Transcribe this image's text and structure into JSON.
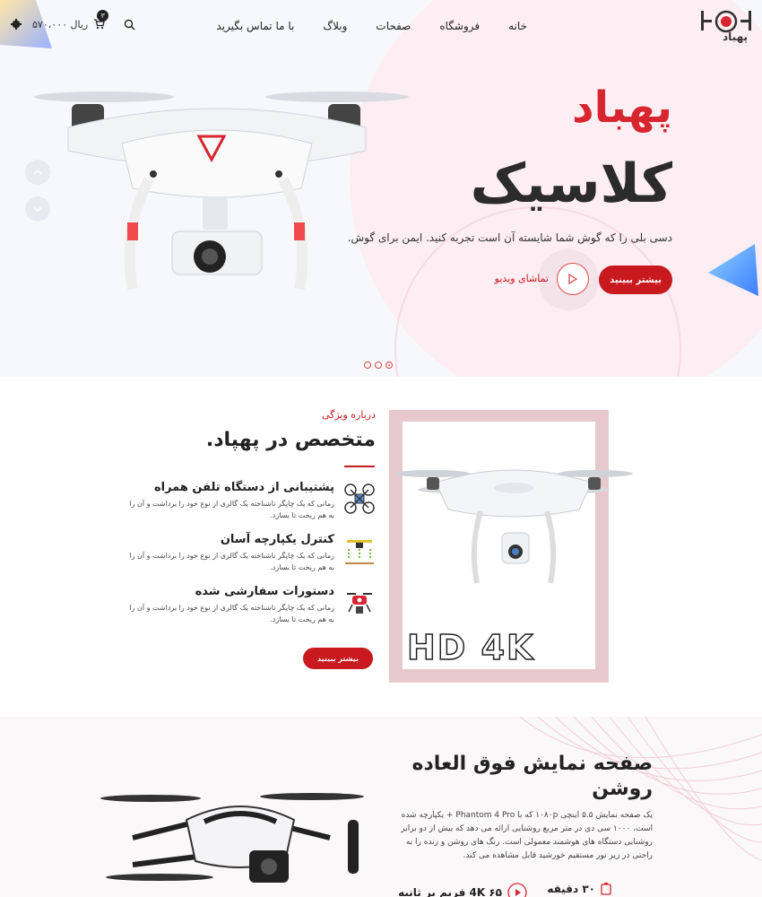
{
  "header": {
    "logo_text": "پهباد",
    "nav": [
      "خانه",
      "فروشگاه",
      "صفحات",
      "وبلاگ",
      "با ما تماس بگیرید"
    ],
    "cart_total": "۵۷۰،۰۰۰ ریال",
    "cart_count": "۳"
  },
  "hero": {
    "title": "پهباد",
    "subtitle": "کلاسیک",
    "description": "دسی بلی را که گوش شما شایسته آن است تجربه کنید. ایمن برای گوش.",
    "more_button": "بیشتر ببینید",
    "watch_video": "تماشای ویدیو",
    "slides": 3
  },
  "about": {
    "small_title": "درباره ویژگی",
    "title": "متخصص در پهپاد.",
    "features": [
      {
        "title": "پشتیبانی از دستگاه تلفن همراه",
        "desc": "زمانی که یک چاپگر ناشناخته یک گالری از نوع خود را برداشت و آن را به هم ریخت تا بسازد."
      },
      {
        "title": "کنترل یکپارچه آسان",
        "desc": "زمانی که یک چاپگر ناشناخته یک گالری از نوع خود را برداشت و آن را به هم ریخت تا بسازد."
      },
      {
        "title": "دستورات سفارشی شده",
        "desc": "زمانی که یک چاپگر ناشناخته یک گالری از نوع خود را برداشت و آن را به هم ریخت تا بسازد."
      }
    ],
    "more_button": "بیشتر ببینید",
    "photo_label": "HD 4K"
  },
  "screen": {
    "title": "صفحه نمایش فوق العاده روشن",
    "description": "یک صفحه نمایش ۵.۵ اینچی ۱۰۸۰p که با Phantom 4 Pro + یکپارچه شده است، ۱۰۰۰ سی دی در متر مربع روشنایی ارائه می دهد که بیش از دو برابر روشنایی دستگاه های هوشمند معمولی است. رنگ های روشن و زنده را به راحتی در زیر نور مستقیم خورشید قابل مشاهده می کند.",
    "stat_1": "۳۰ دقیقه",
    "stat_2": "4K ۶۵ فریم بر ثانیه"
  },
  "colors": {
    "accent": "#c8191f",
    "dark": "#222222"
  }
}
